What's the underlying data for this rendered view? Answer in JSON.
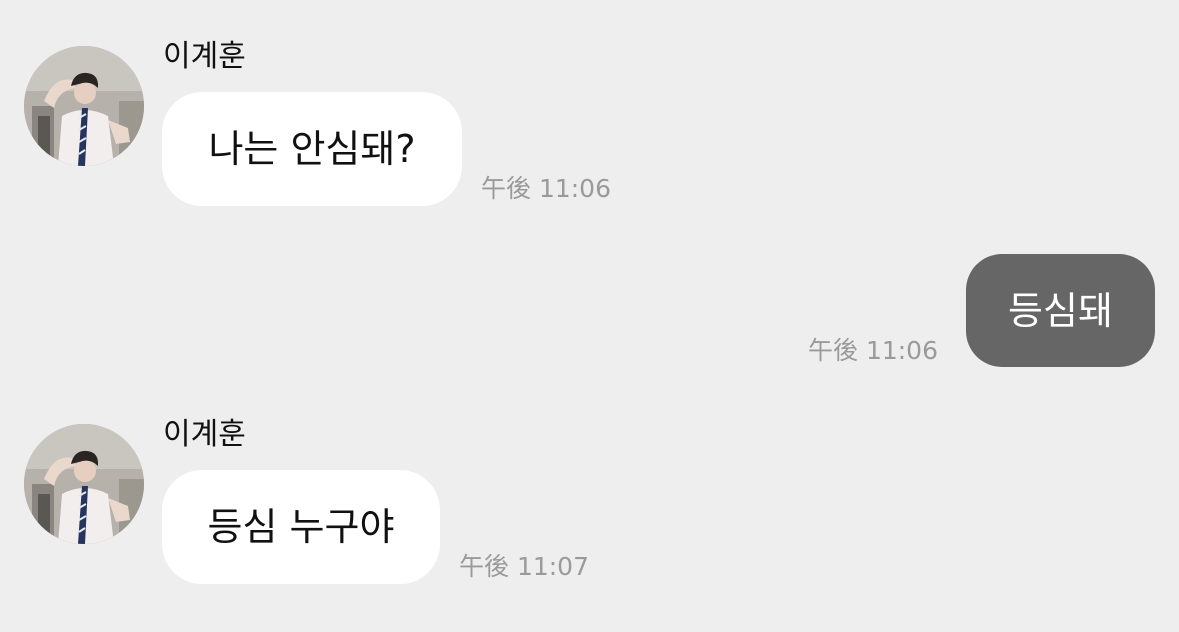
{
  "messages": [
    {
      "direction": "incoming",
      "sender": "이계훈",
      "text": "나는 안심돼?",
      "time": "午後 11:06"
    },
    {
      "direction": "outgoing",
      "text": "등심돼",
      "time": "午後 11:06"
    },
    {
      "direction": "incoming",
      "sender": "이계훈",
      "text": "등심 누구야",
      "time": "午後 11:07"
    }
  ],
  "colors": {
    "background": "#eeeeee",
    "incoming_bubble": "#ffffff",
    "outgoing_bubble": "#666666",
    "timestamp": "#9a9a9a"
  },
  "avatar_icon": "profile-photo"
}
